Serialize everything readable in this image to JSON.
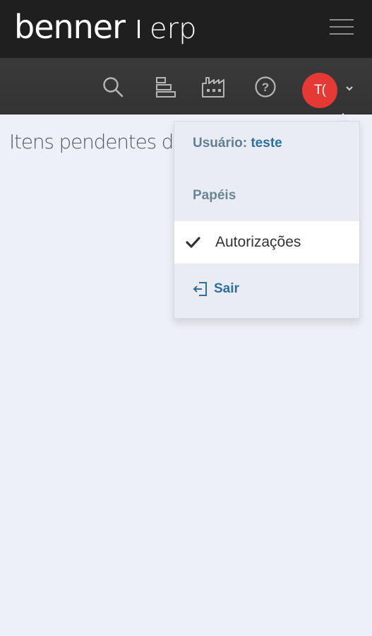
{
  "header": {
    "brand": "benner",
    "product": "erp",
    "menu_icon": "hamburger-icon"
  },
  "toolbar": {
    "icons": [
      "search-icon",
      "tasks-icon",
      "factory-icon",
      "help-icon"
    ],
    "avatar_initials": "T(",
    "avatar_color": "#e53935",
    "user_menu_icon": "chevron-down-icon"
  },
  "page": {
    "title": "Itens pendentes de"
  },
  "user_menu": {
    "user_label": "Usuário:",
    "user_name": "teste",
    "roles_header": "Papéis",
    "roles": [
      {
        "label": "Autorizações",
        "selected": true
      }
    ],
    "logout_label": "Sair",
    "logout_icon": "logout-icon",
    "accent_color": "#2f6f9f"
  }
}
